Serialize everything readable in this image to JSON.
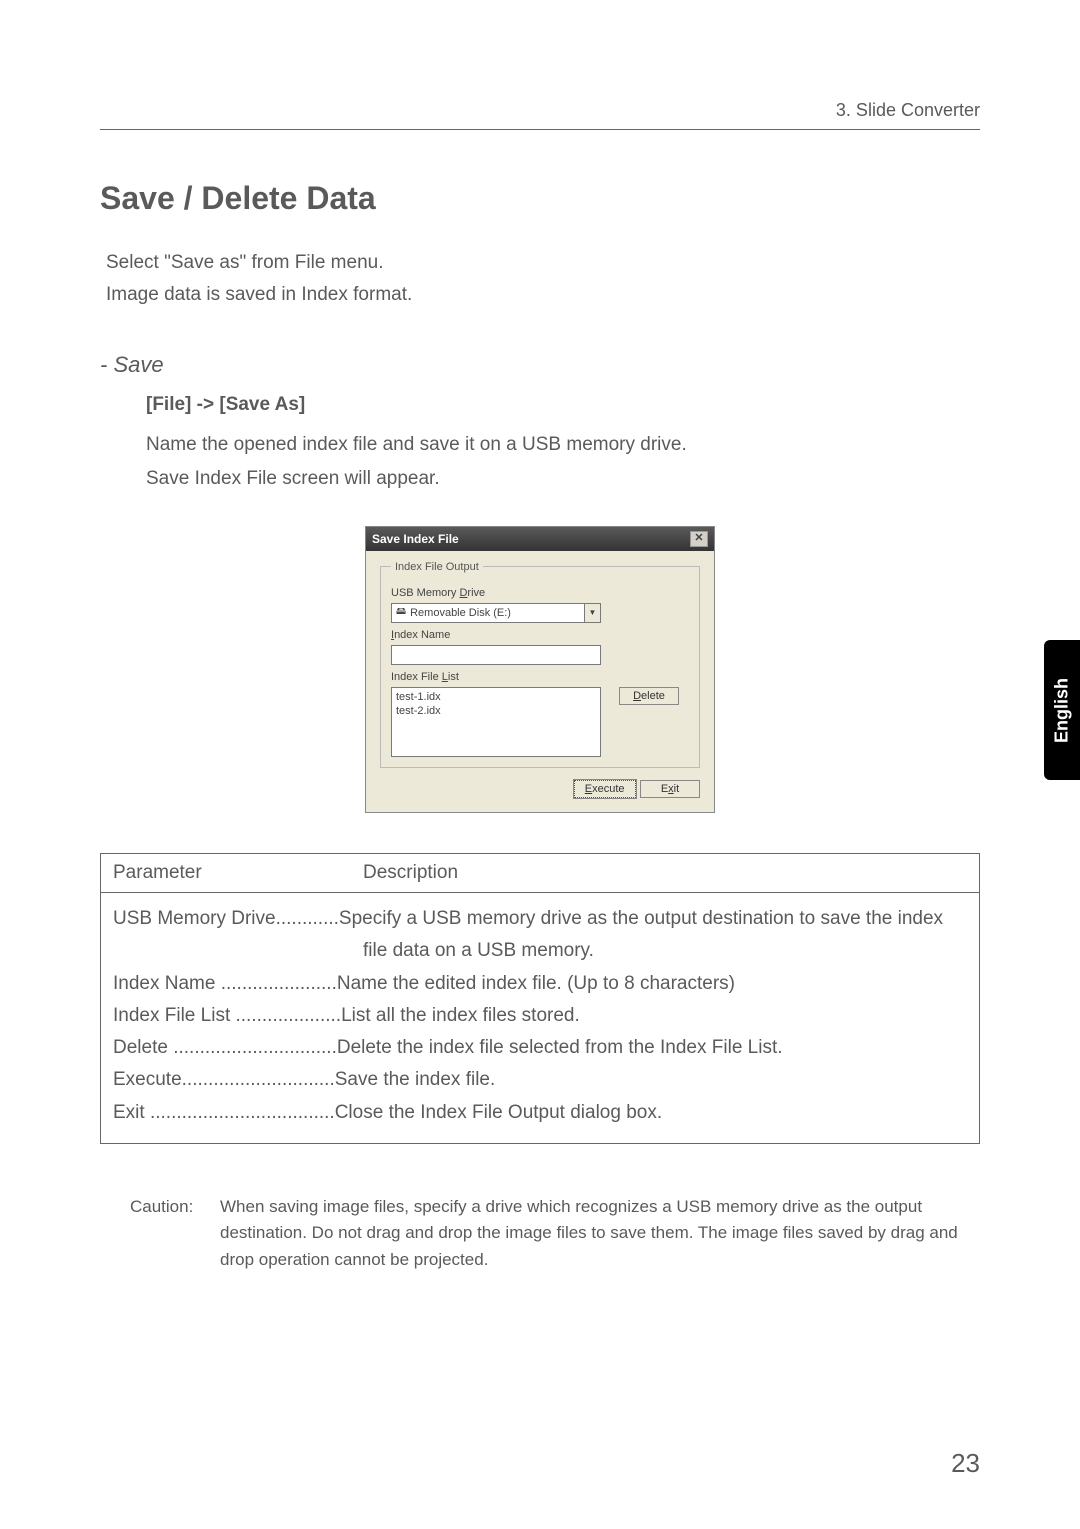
{
  "header": {
    "chapter": "3. Slide Converter"
  },
  "title": "Save / Delete Data",
  "intro": {
    "line1": "Select \"Save as\" from File menu.",
    "line2": " Image data is saved in Index format."
  },
  "save": {
    "heading": "- Save",
    "menupath": "[File] -> [Save As]",
    "line1": "Name the opened index file and save it on a USB memory drive.",
    "line2": "Save Index File screen will appear."
  },
  "dialog": {
    "title": "Save Index File",
    "group_legend": "Index File Output",
    "usb_label_pre": "USB Memory ",
    "usb_label_u": "D",
    "usb_label_post": "rive",
    "drive_value": "Removable Disk (E:)",
    "index_name_u": "I",
    "index_name_post": "ndex Name",
    "list_label_pre": "Index File ",
    "list_label_u": "L",
    "list_label_post": "ist",
    "list_item1": "test-1.idx",
    "list_item2": "test-2.idx",
    "delete_u": "D",
    "delete_post": "elete",
    "execute_u": "E",
    "execute_post": "xecute",
    "exit_pre": "E",
    "exit_u": "x",
    "exit_post": "it"
  },
  "table": {
    "col1": "Parameter",
    "col2": "Description",
    "r1": "USB Memory Drive............Specify a USB memory drive as the output destination to save the index file data on a USB memory.",
    "r2": "Index Name ......................Name the edited index file.  (Up to 8 characters)",
    "r3": "Index File List ....................List all the index files stored.",
    "r4": "Delete ...............................Delete the index file selected from the Index File List.",
    "r5": "Execute.............................Save the index file.",
    "r6": "Exit ...................................Close the Index File Output dialog box."
  },
  "caution": {
    "label": "Caution:",
    "text": "When saving image files, specify a drive which recognizes a USB memory drive as the output destination.  Do not drag and drop the image files to save them.  The image files saved by drag and drop operation cannot be projected."
  },
  "sidetab": "English",
  "pagenum": "23"
}
